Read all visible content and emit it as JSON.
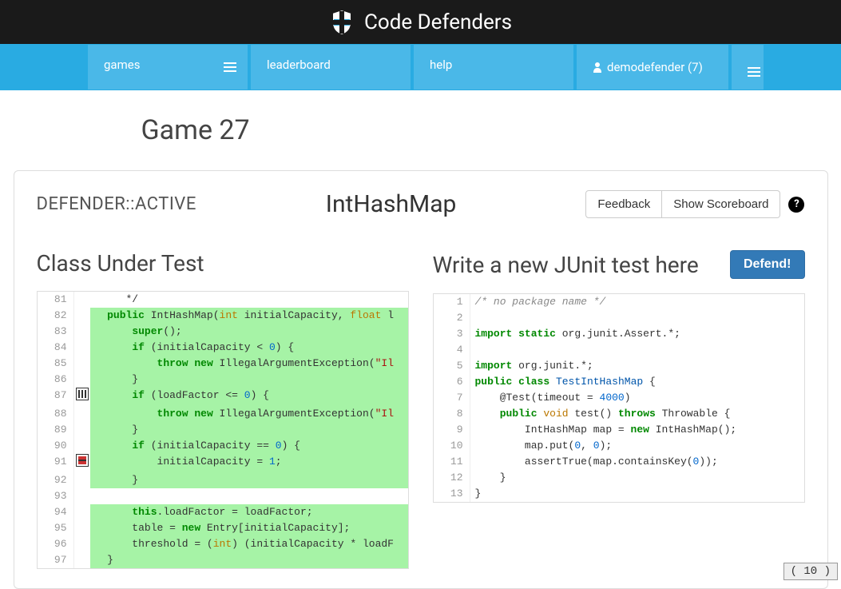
{
  "brand": "Code Defenders",
  "nav": {
    "games": "games",
    "leaderboard": "leaderboard",
    "help": "help",
    "user": "demodefender (7)"
  },
  "page_title": "Game 27",
  "status": "DEFENDER::ACTIVE",
  "class_name": "IntHashMap",
  "buttons": {
    "feedback": "Feedback",
    "scoreboard": "Show Scoreboard",
    "defend": "Defend!"
  },
  "panel_left_title": "Class Under Test",
  "panel_right_title": "Write a new JUnit test here",
  "corner": "( 10 )",
  "left_code": {
    "start": 81,
    "lines": [
      {
        "t": "     */",
        "hl": false,
        "icon": null
      },
      {
        "t": "  public IntHashMap(int initialCapacity, float l",
        "hl": true,
        "icon": null,
        "tokens": [
          {
            "s": "  "
          },
          {
            "s": "public",
            "c": "kw"
          },
          {
            "s": " IntHashMap("
          },
          {
            "s": "int",
            "c": "type"
          },
          {
            "s": " initialCapacity, "
          },
          {
            "s": "float",
            "c": "type"
          },
          {
            "s": " l"
          }
        ]
      },
      {
        "t": "      super();",
        "hl": true,
        "icon": null,
        "tokens": [
          {
            "s": "      "
          },
          {
            "s": "super",
            "c": "kw"
          },
          {
            "s": "();"
          }
        ]
      },
      {
        "t": "      if (initialCapacity < 0) {",
        "hl": true,
        "icon": null,
        "tokens": [
          {
            "s": "      "
          },
          {
            "s": "if",
            "c": "kw"
          },
          {
            "s": " (initialCapacity < "
          },
          {
            "s": "0",
            "c": "num"
          },
          {
            "s": ") {"
          }
        ]
      },
      {
        "t": "          throw new IllegalArgumentException(\"Il",
        "hl": true,
        "icon": null,
        "tokens": [
          {
            "s": "          "
          },
          {
            "s": "throw",
            "c": "kw"
          },
          {
            "s": " "
          },
          {
            "s": "new",
            "c": "kw"
          },
          {
            "s": " IllegalArgumentException("
          },
          {
            "s": "\"Il",
            "c": "str"
          }
        ]
      },
      {
        "t": "      }",
        "hl": true,
        "icon": null
      },
      {
        "t": "      if (loadFactor <= 0) {",
        "hl": true,
        "icon": "flag",
        "tokens": [
          {
            "s": "      "
          },
          {
            "s": "if",
            "c": "kw"
          },
          {
            "s": " (loadFactor <= "
          },
          {
            "s": "0",
            "c": "num"
          },
          {
            "s": ") {"
          }
        ]
      },
      {
        "t": "          throw new IllegalArgumentException(\"Il",
        "hl": true,
        "icon": null,
        "tokens": [
          {
            "s": "          "
          },
          {
            "s": "throw",
            "c": "kw"
          },
          {
            "s": " "
          },
          {
            "s": "new",
            "c": "kw"
          },
          {
            "s": " IllegalArgumentException("
          },
          {
            "s": "\"Il",
            "c": "str"
          }
        ]
      },
      {
        "t": "      }",
        "hl": true,
        "icon": null
      },
      {
        "t": "      if (initialCapacity == 0) {",
        "hl": true,
        "icon": null,
        "tokens": [
          {
            "s": "      "
          },
          {
            "s": "if",
            "c": "kw"
          },
          {
            "s": " (initialCapacity == "
          },
          {
            "s": "0",
            "c": "num"
          },
          {
            "s": ") {"
          }
        ]
      },
      {
        "t": "          initialCapacity = 1;",
        "hl": true,
        "icon": "mutant",
        "tokens": [
          {
            "s": "          initialCapacity = "
          },
          {
            "s": "1",
            "c": "num"
          },
          {
            "s": ";"
          }
        ]
      },
      {
        "t": "      }",
        "hl": true,
        "icon": null
      },
      {
        "t": "",
        "hl": false,
        "icon": null
      },
      {
        "t": "      this.loadFactor = loadFactor;",
        "hl": true,
        "icon": null,
        "tokens": [
          {
            "s": "      "
          },
          {
            "s": "this",
            "c": "kw"
          },
          {
            "s": ".loadFactor = loadFactor;"
          }
        ]
      },
      {
        "t": "      table = new Entry[initialCapacity];",
        "hl": true,
        "icon": null,
        "tokens": [
          {
            "s": "      table = "
          },
          {
            "s": "new",
            "c": "kw"
          },
          {
            "s": " Entry[initialCapacity];"
          }
        ]
      },
      {
        "t": "      threshold = (int) (initialCapacity * loadF",
        "hl": true,
        "icon": null,
        "tokens": [
          {
            "s": "      threshold = ("
          },
          {
            "s": "int",
            "c": "type"
          },
          {
            "s": ") (initialCapacity * loadF"
          }
        ]
      },
      {
        "t": "  }",
        "hl": true,
        "icon": null
      }
    ]
  },
  "right_code": {
    "start": 1,
    "lines": [
      {
        "tokens": [
          {
            "s": "/* no package name */",
            "c": "cmt"
          }
        ]
      },
      {
        "tokens": [
          {
            "s": ""
          }
        ]
      },
      {
        "tokens": [
          {
            "s": "import",
            "c": "kw"
          },
          {
            "s": " "
          },
          {
            "s": "static",
            "c": "kw"
          },
          {
            "s": " org.junit.Assert.*;"
          }
        ]
      },
      {
        "tokens": [
          {
            "s": ""
          }
        ]
      },
      {
        "tokens": [
          {
            "s": "import",
            "c": "kw"
          },
          {
            "s": " org.junit.*;"
          }
        ]
      },
      {
        "tokens": [
          {
            "s": "public",
            "c": "kw"
          },
          {
            "s": " "
          },
          {
            "s": "class",
            "c": "kw"
          },
          {
            "s": " "
          },
          {
            "s": "TestIntHashMap",
            "c": "cls"
          },
          {
            "s": " {"
          }
        ]
      },
      {
        "tokens": [
          {
            "s": "    @Test(timeout = "
          },
          {
            "s": "4000",
            "c": "num"
          },
          {
            "s": ")"
          }
        ]
      },
      {
        "tokens": [
          {
            "s": "    "
          },
          {
            "s": "public",
            "c": "kw"
          },
          {
            "s": " "
          },
          {
            "s": "void",
            "c": "type"
          },
          {
            "s": " test() "
          },
          {
            "s": "throws",
            "c": "kw"
          },
          {
            "s": " Throwable {"
          }
        ]
      },
      {
        "tokens": [
          {
            "s": "        IntHashMap map = "
          },
          {
            "s": "new",
            "c": "kw"
          },
          {
            "s": " IntHashMap();"
          }
        ]
      },
      {
        "tokens": [
          {
            "s": "        map.put("
          },
          {
            "s": "0",
            "c": "num"
          },
          {
            "s": ", "
          },
          {
            "s": "0",
            "c": "num"
          },
          {
            "s": ");"
          }
        ]
      },
      {
        "tokens": [
          {
            "s": "        assertTrue(map.containsKey("
          },
          {
            "s": "0",
            "c": "num"
          },
          {
            "s": "));"
          }
        ]
      },
      {
        "tokens": [
          {
            "s": "    }"
          }
        ]
      },
      {
        "tokens": [
          {
            "s": "}"
          }
        ]
      }
    ]
  }
}
